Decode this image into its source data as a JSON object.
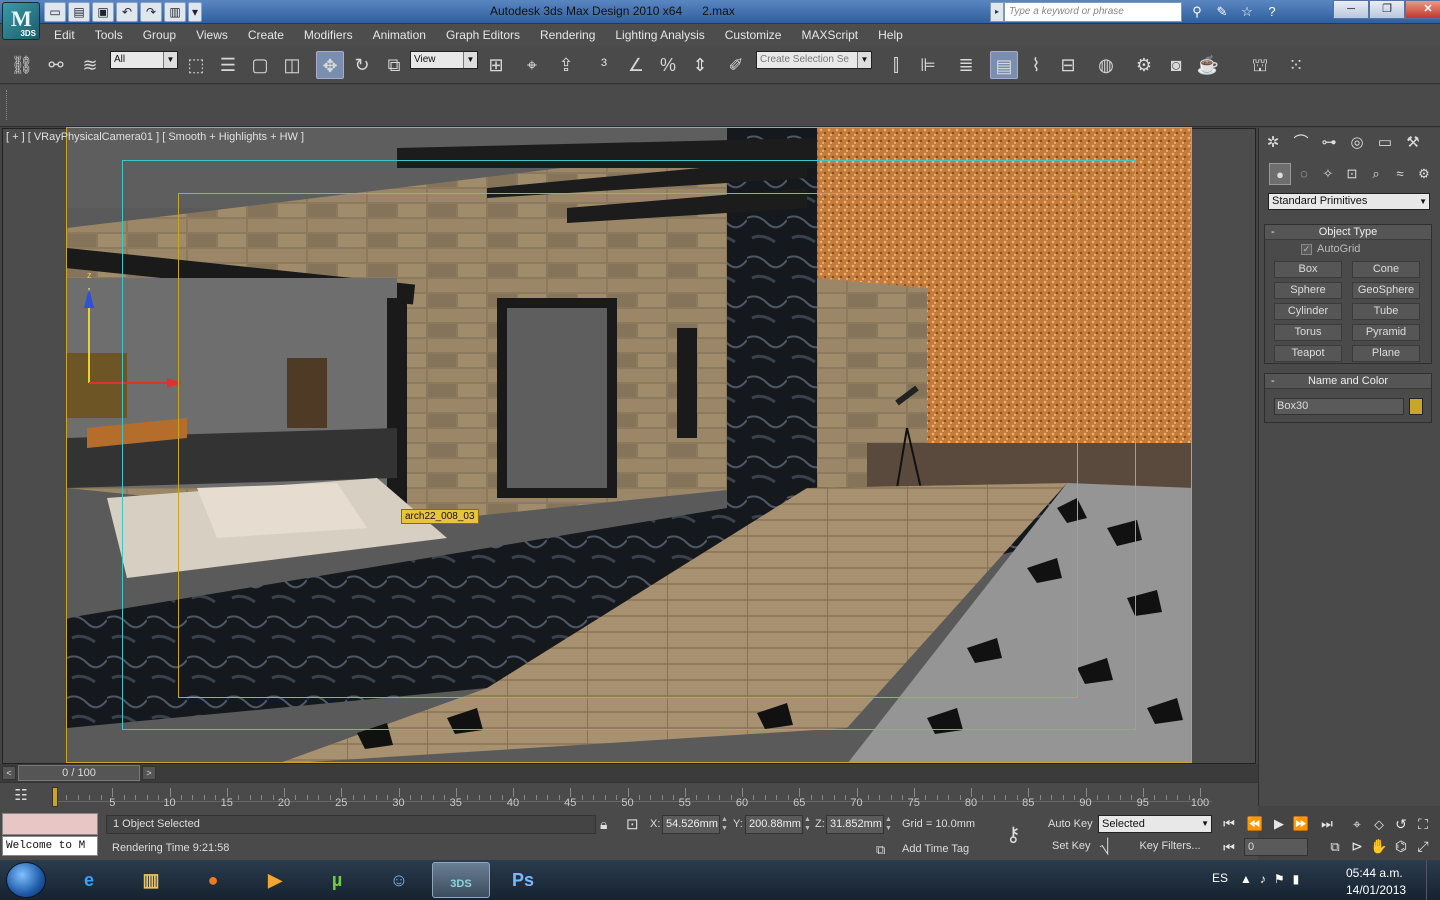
{
  "titlebar": {
    "app_logo_text": "M",
    "app_logo_sub": "3DS",
    "quick_access": [
      "new-icon",
      "open-icon",
      "save-icon",
      "undo-icon",
      "redo-icon",
      "project-folder-icon",
      "dropdown-arrow-icon"
    ],
    "title": "Autodesk 3ds Max Design 2010 x64",
    "filename": "2.max",
    "search_placeholder": "Type a keyword or phrase",
    "infocenter_icons": [
      "binoculars-icon",
      "tools-icon",
      "star-icon",
      "help-icon"
    ],
    "window_buttons": {
      "minimize": "─",
      "maximize": "❐",
      "close": "✕"
    }
  },
  "menubar": {
    "items": [
      "Edit",
      "Tools",
      "Group",
      "Views",
      "Create",
      "Modifiers",
      "Animation",
      "Graph Editors",
      "Rendering",
      "Lighting Analysis",
      "Customize",
      "MAXScript",
      "Help"
    ]
  },
  "toolbar": {
    "selection_filter": "All",
    "reference_coord": "View",
    "named_selection": "Create Selection Se"
  },
  "viewport": {
    "label": "[ + ] [ VRayPhysicalCamera01 ] [ Smooth + Highlights + HW ]",
    "object_tooltip": "arch22_008_03",
    "gizmo_axis_label": "z"
  },
  "command_panel": {
    "primitive_type": "Standard Primitives",
    "object_type": {
      "title": "Object Type",
      "autogrid": "AutoGrid",
      "buttons": [
        "Box",
        "Cone",
        "Sphere",
        "GeoSphere",
        "Cylinder",
        "Tube",
        "Torus",
        "Pyramid",
        "Teapot",
        "Plane"
      ]
    },
    "name_and_color": {
      "title": "Name and Color",
      "name": "Box30",
      "color": "#c7a62a"
    }
  },
  "timeline": {
    "frame_display": "0 / 100",
    "ticks": [
      "5",
      "10",
      "15",
      "20",
      "25",
      "30",
      "35",
      "40",
      "45",
      "50",
      "55",
      "60",
      "65",
      "70",
      "75",
      "80",
      "85",
      "90",
      "95",
      "100"
    ]
  },
  "status": {
    "maxscript_text": "Welcome to M",
    "selected": "1 Object Selected",
    "prompt": "Rendering Time  9:21:58",
    "x_label": "X:",
    "x": "54.526mm",
    "y_label": "Y:",
    "y": "200.88mm",
    "z_label": "Z:",
    "z": "31.852mm",
    "grid": "Grid = 10.0mm",
    "add_time_tag": "Add Time Tag",
    "auto_key": "Auto Key",
    "set_key": "Set Key",
    "key_mode": "Selected",
    "key_filters": "Key Filters...",
    "current_frame": "0"
  },
  "taskbar": {
    "language": "ES",
    "time": "05:44 a.m.",
    "date": "14/01/2013",
    "apps": [
      "Internet Explorer",
      "Windows Explorer",
      "Firefox",
      "Media Player",
      "uTorrent",
      "Messenger",
      "3ds Max",
      "Photoshop"
    ],
    "ps_label": "Ps",
    "max_label": "3DS"
  }
}
